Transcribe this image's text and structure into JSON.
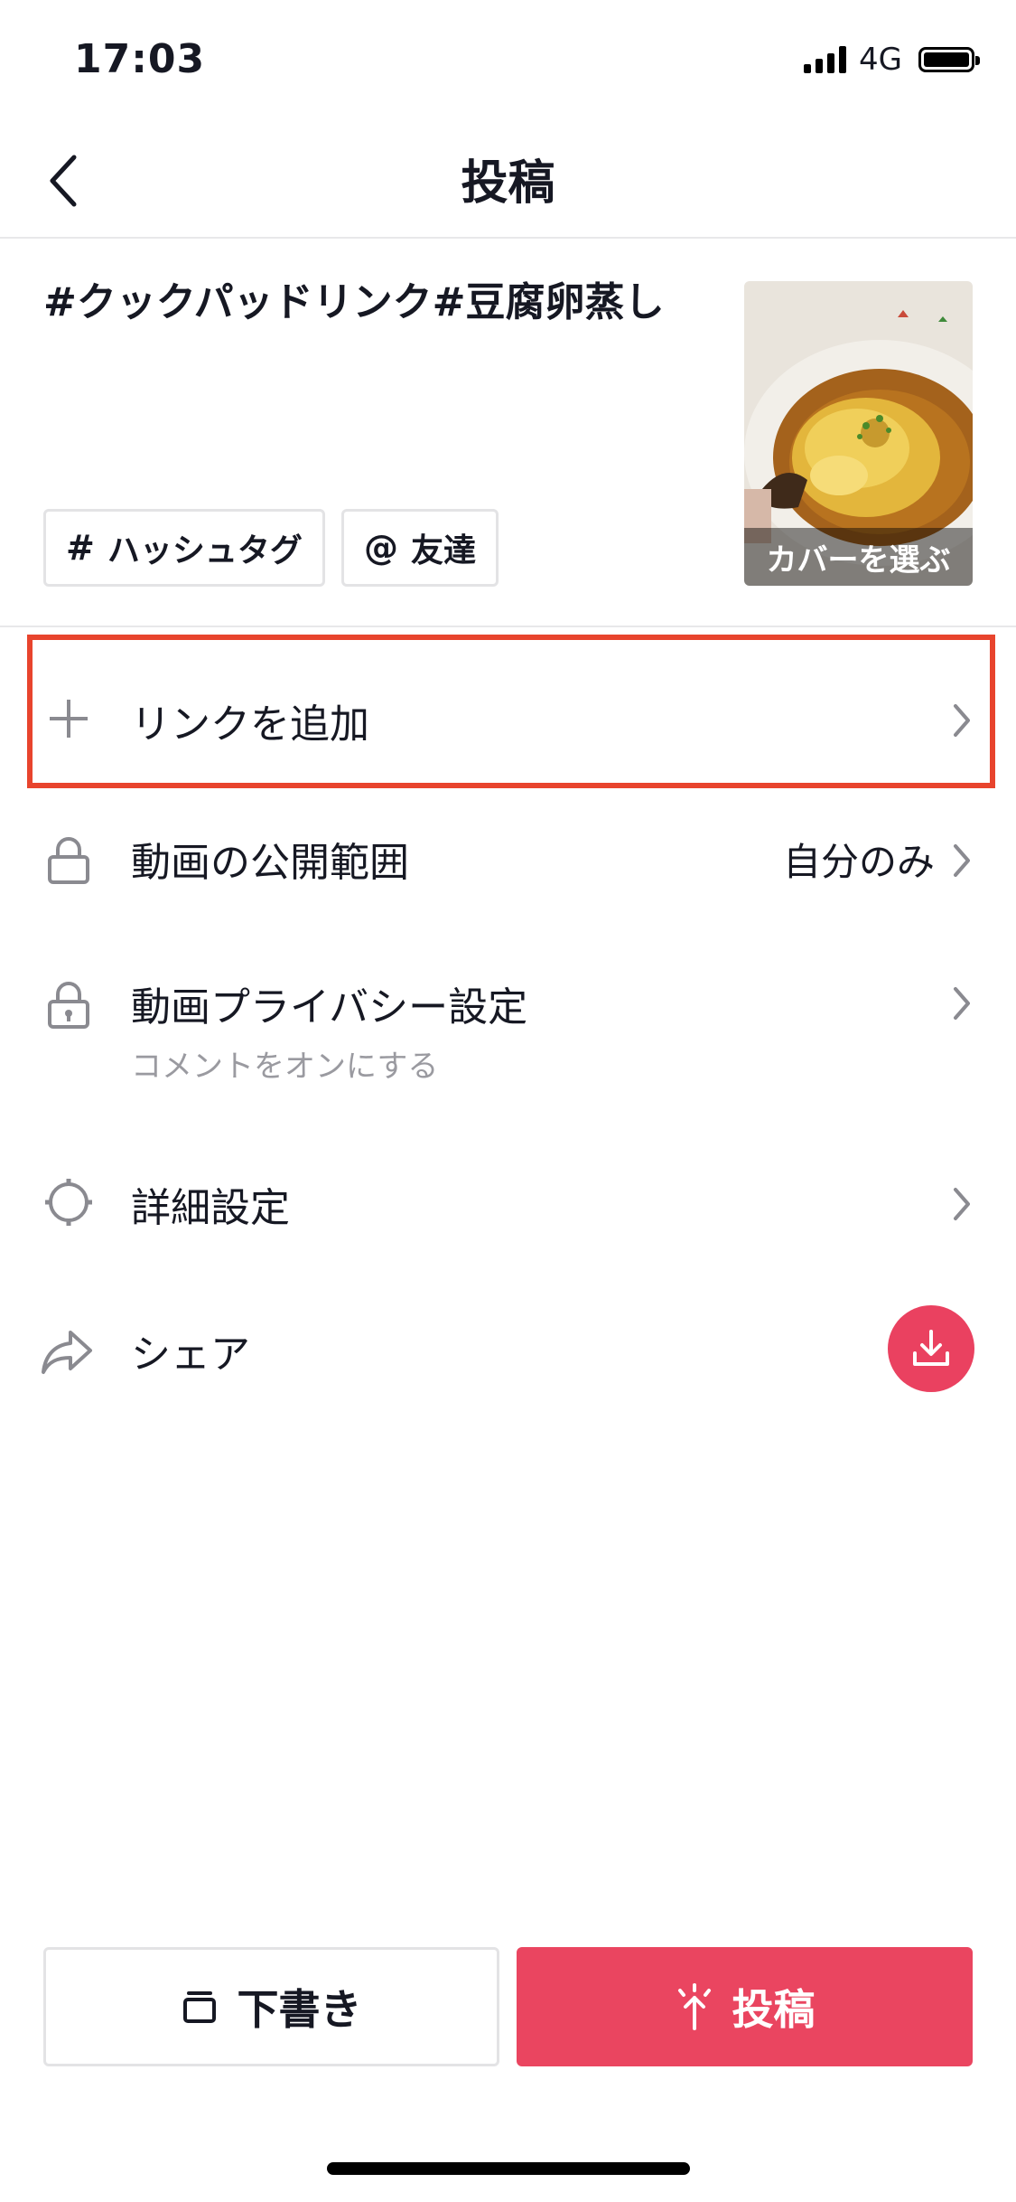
{
  "status_bar": {
    "time": "17:03",
    "network": "4G"
  },
  "header": {
    "title": "投稿"
  },
  "post": {
    "caption": "#クックパッドリンク#豆腐卵蒸し",
    "hashtag_symbol": "#",
    "hashtag_label": "ハッシュタグ",
    "mention_symbol": "@",
    "mention_label": "友達",
    "cover_label": "カバーを選ぶ"
  },
  "settings": {
    "add_link": {
      "label": "リンクを追加",
      "icon": "plus-icon"
    },
    "visibility": {
      "label": "動画の公開範囲",
      "value": "自分のみ",
      "icon": "lock-icon"
    },
    "privacy": {
      "label": "動画プライバシー設定",
      "sub": "コメントをオンにする",
      "icon": "lock-icon"
    },
    "advanced": {
      "label": "詳細設定",
      "icon": "gear-icon"
    },
    "share": {
      "label": "シェア",
      "icon": "share-arrow-icon"
    }
  },
  "actions": {
    "draft_label": "下書き",
    "post_label": "投稿"
  },
  "colors": {
    "accent": "#ea4560",
    "highlight": "#e8442d",
    "divider": "#e8e8ea"
  }
}
